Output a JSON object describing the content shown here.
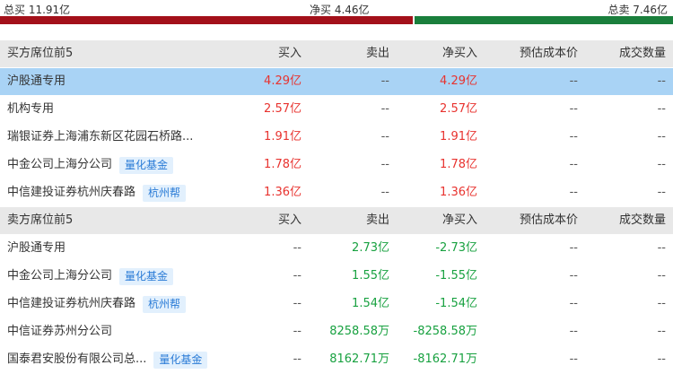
{
  "summary": {
    "total_buy": "总买 11.91亿",
    "net_buy": "净买 4.46亿",
    "total_sell": "总卖 7.46亿",
    "buy_share": 0.615,
    "sell_share": 0.385,
    "buy_color": "#a3101a",
    "sell_color": "#1a7f3c"
  },
  "columns": {
    "buy_header": "买方席位前5",
    "sell_header": "卖方席位前5",
    "buy": "买入",
    "sell": "卖出",
    "net": "净买入",
    "cost": "预估成本价",
    "volume": "成交数量"
  },
  "buy_rows": [
    {
      "name": "沪股通专用",
      "tag": "",
      "buy": "4.29亿",
      "sell": "--",
      "net": "4.29亿",
      "cost": "--",
      "volume": "--"
    },
    {
      "name": "机构专用",
      "tag": "",
      "buy": "2.57亿",
      "sell": "--",
      "net": "2.57亿",
      "cost": "--",
      "volume": "--"
    },
    {
      "name": "瑞银证券上海浦东新区花园石桥路...",
      "tag": "",
      "buy": "1.91亿",
      "sell": "--",
      "net": "1.91亿",
      "cost": "--",
      "volume": "--"
    },
    {
      "name": "中金公司上海分公司",
      "tag": "量化基金",
      "buy": "1.78亿",
      "sell": "--",
      "net": "1.78亿",
      "cost": "--",
      "volume": "--"
    },
    {
      "name": "中信建投证券杭州庆春路",
      "tag": "杭州帮",
      "buy": "1.36亿",
      "sell": "--",
      "net": "1.36亿",
      "cost": "--",
      "volume": "--"
    }
  ],
  "sell_rows": [
    {
      "name": "沪股通专用",
      "tag": "",
      "buy": "--",
      "sell": "2.73亿",
      "net": "-2.73亿",
      "cost": "--",
      "volume": "--"
    },
    {
      "name": "中金公司上海分公司",
      "tag": "量化基金",
      "buy": "--",
      "sell": "1.55亿",
      "net": "-1.55亿",
      "cost": "--",
      "volume": "--"
    },
    {
      "name": "中信建投证券杭州庆春路",
      "tag": "杭州帮",
      "buy": "--",
      "sell": "1.54亿",
      "net": "-1.54亿",
      "cost": "--",
      "volume": "--"
    },
    {
      "name": "中信证券苏州分公司",
      "tag": "",
      "buy": "--",
      "sell": "8258.58万",
      "net": "-8258.58万",
      "cost": "--",
      "volume": "--"
    },
    {
      "name": "国泰君安股份有限公司总...",
      "tag": "量化基金",
      "buy": "--",
      "sell": "8162.71万",
      "net": "-8162.71万",
      "cost": "--",
      "volume": "--"
    }
  ]
}
